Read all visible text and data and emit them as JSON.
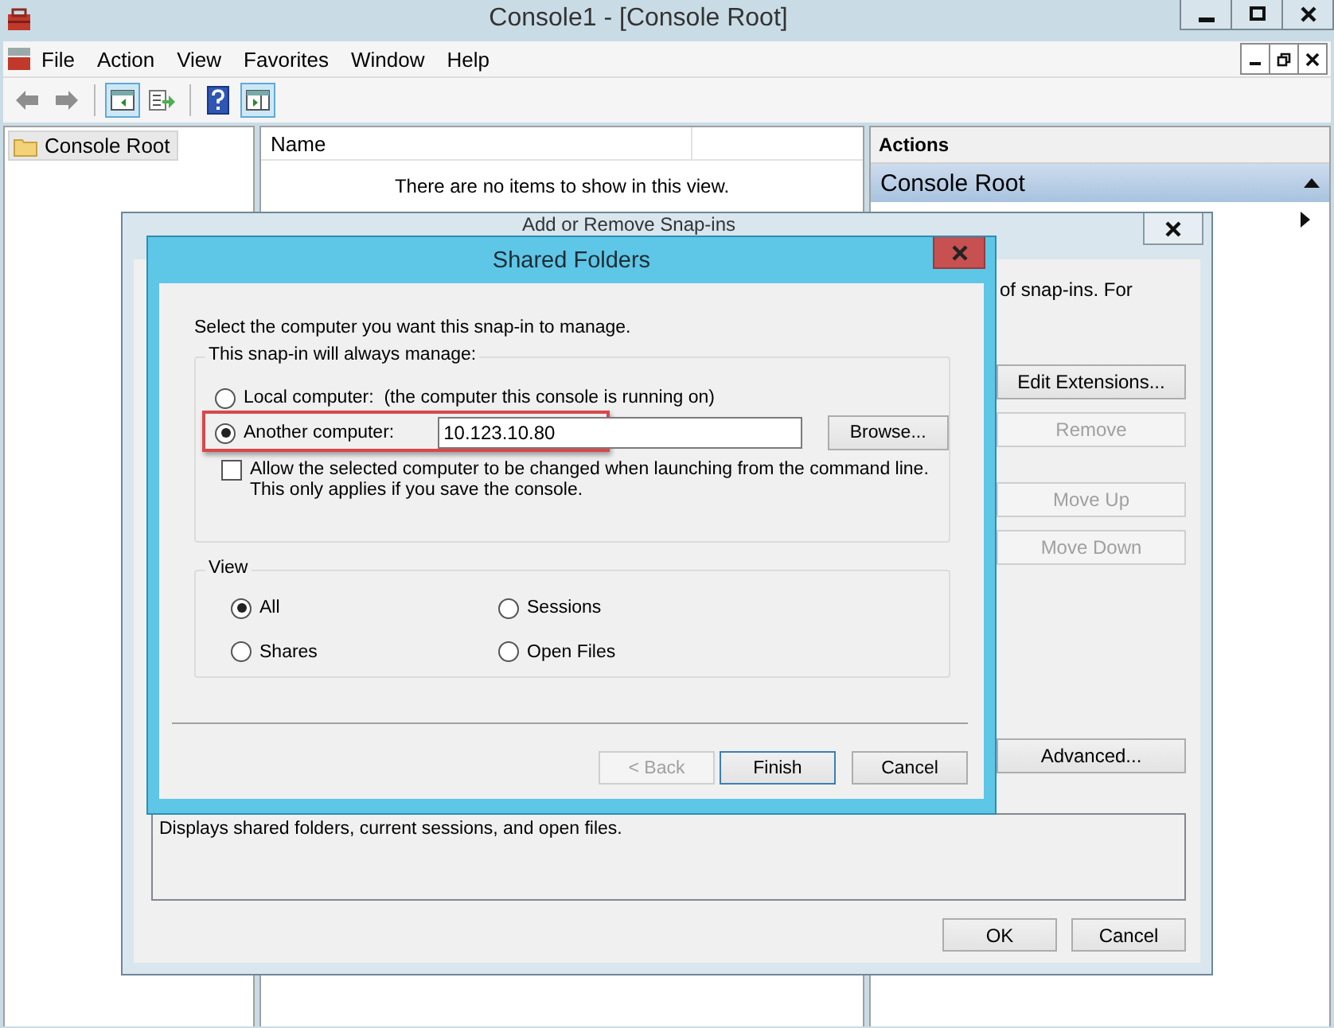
{
  "window": {
    "title": "Console1 - [Console Root]"
  },
  "menu": [
    "File",
    "Action",
    "View",
    "Favorites",
    "Window",
    "Help"
  ],
  "toolbar": {
    "console_tree_shown": true,
    "action_pane_shown": true
  },
  "tree": [
    {
      "label": "Console Root",
      "selected": true
    }
  ],
  "list_view": {
    "columns": [
      "Name"
    ],
    "empty_message": "There are no items to show in this view."
  },
  "actions": {
    "header": "Actions",
    "section": "Console Root",
    "expanded": true
  },
  "snapin_dialog": {
    "title": "Add or Remove Snap-ins",
    "intro_fragment": "of snap-ins. For",
    "side_buttons": [
      {
        "label": "Edit Extensions...",
        "disabled": false
      },
      {
        "label": "Remove",
        "disabled": true
      },
      {
        "label": "Move Up",
        "disabled": true
      },
      {
        "label": "Move Down",
        "disabled": true
      },
      {
        "label": "Advanced...",
        "disabled": false
      }
    ],
    "description": "Displays shared folders, current sessions, and open files.",
    "buttons": [
      "OK",
      "Cancel"
    ]
  },
  "shared_folders_dialog": {
    "title": "Shared Folders",
    "prompt": "Select the computer you want this snap-in to manage.",
    "manage_group": {
      "label": "This snap-in will always manage:",
      "options": [
        {
          "label": "Local computer:  (the computer this console is running on)",
          "selected": false
        },
        {
          "label": "Another computer:",
          "selected": true
        }
      ],
      "computer_field": {
        "value": "10.123.10.80"
      },
      "browse": "Browse...",
      "allow_change": {
        "label": "Allow the selected computer to be changed when launching from the command line.  This only applies if you save the console.",
        "checked": false
      }
    },
    "view_group": {
      "label": "View",
      "options": [
        {
          "label": "All",
          "selected": true
        },
        {
          "label": "Sessions",
          "selected": false
        },
        {
          "label": "Shares",
          "selected": false
        },
        {
          "label": "Open Files",
          "selected": false
        }
      ]
    },
    "buttons": [
      {
        "label": "< Back",
        "disabled": true,
        "default": false
      },
      {
        "label": "Finish",
        "disabled": false,
        "default": true
      },
      {
        "label": "Cancel",
        "disabled": false,
        "default": false
      }
    ]
  }
}
